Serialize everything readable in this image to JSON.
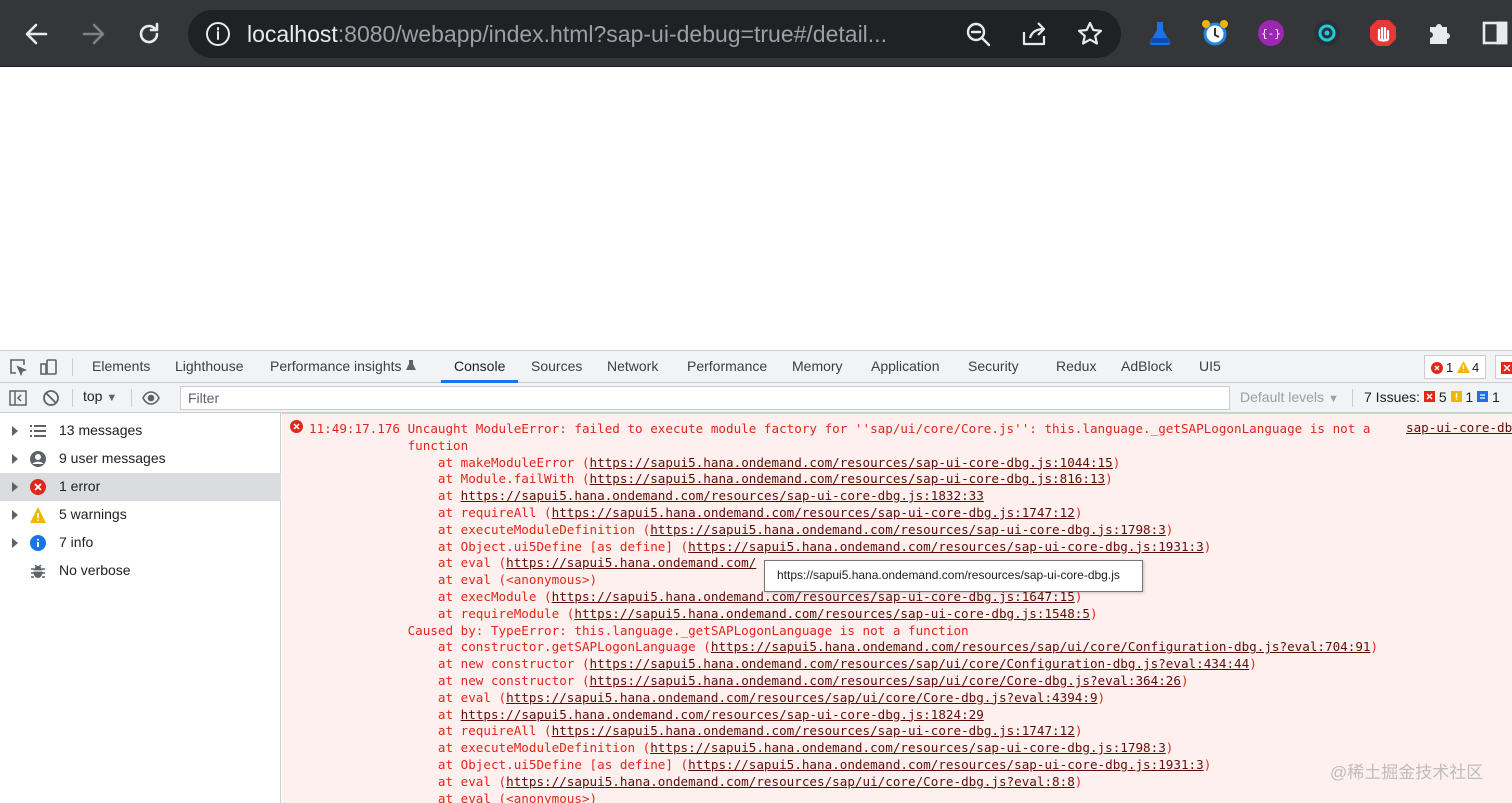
{
  "browser": {
    "url_host": "localhost",
    "url_rest": ":8080/webapp/index.html?sap-ui-debug=true#/detail..."
  },
  "devtools": {
    "tabs": [
      "Elements",
      "Lighthouse",
      "Performance insights",
      "Console",
      "Sources",
      "Network",
      "Performance",
      "Memory",
      "Application",
      "Security",
      "Redux",
      "AdBlock",
      "UI5"
    ],
    "active_tab": "Console",
    "badge": {
      "errors": "1",
      "warnings": "4"
    },
    "toolbar": {
      "context": "top",
      "filter_placeholder": "Filter",
      "levels": "Default levels",
      "issues_label": "7 Issues:",
      "issues_errors": "5",
      "issues_warnings": "1",
      "issues_info": "1"
    },
    "sidebar": [
      {
        "label": "13 messages",
        "icon": "list-icon"
      },
      {
        "label": "9 user messages",
        "icon": "user-icon"
      },
      {
        "label": "1 error",
        "icon": "error-icon",
        "selected": true
      },
      {
        "label": "5 warnings",
        "icon": "warning-icon"
      },
      {
        "label": "7 info",
        "icon": "info-icon"
      },
      {
        "label": "No verbose",
        "icon": "bug-icon"
      }
    ],
    "console": {
      "timestamp": "11:49:17.176",
      "source_link": "sap-ui-core-dbg.js",
      "tooltip": "https://sapui5.hana.ondemand.com/resources/sap-ui-core-dbg.js",
      "lines": [
        {
          "pre": "11:49:17.176 Uncaught ModuleError: failed to execute module factory for ''sap/ui/core/Core.js'': this.language._getSAPLogonLanguage is not a",
          "link": "",
          "post": ""
        },
        {
          "pre": "             function",
          "link": "",
          "post": ""
        },
        {
          "pre": "                 at makeModuleError (",
          "link": "https://sapui5.hana.ondemand.com/resources/sap-ui-core-dbg.js:1044:15",
          "post": ")"
        },
        {
          "pre": "                 at Module.failWith (",
          "link": "https://sapui5.hana.ondemand.com/resources/sap-ui-core-dbg.js:816:13",
          "post": ")"
        },
        {
          "pre": "                 at ",
          "link": "https://sapui5.hana.ondemand.com/resources/sap-ui-core-dbg.js:1832:33",
          "post": ""
        },
        {
          "pre": "                 at requireAll (",
          "link": "https://sapui5.hana.ondemand.com/resources/sap-ui-core-dbg.js:1747:12",
          "post": ")"
        },
        {
          "pre": "                 at executeModuleDefinition (",
          "link": "https://sapui5.hana.ondemand.com/resources/sap-ui-core-dbg.js:1798:3",
          "post": ")"
        },
        {
          "pre": "                 at Object.ui5Define [as define] (",
          "link": "https://sapui5.hana.ondemand.com/resources/sap-ui-core-dbg.js:1931:3",
          "post": ")"
        },
        {
          "pre": "                 at eval (",
          "link": "https://sapui5.hana.ondemand.com/",
          "post": ""
        },
        {
          "pre": "                 at eval (<anonymous>)",
          "link": "",
          "post": ""
        },
        {
          "pre": "                 at execModule (",
          "link": "https://sapui5.hana.ondemand.com/resources/sap-ui-core-dbg.js:1647:15",
          "post": ")"
        },
        {
          "pre": "                 at requireModule (",
          "link": "https://sapui5.hana.ondemand.com/resources/sap-ui-core-dbg.js:1548:5",
          "post": ")"
        },
        {
          "pre": "             Caused by: TypeError: this.language._getSAPLogonLanguage is not a function",
          "link": "",
          "post": ""
        },
        {
          "pre": "                 at constructor.getSAPLogonLanguage (",
          "link": "https://sapui5.hana.ondemand.com/resources/sap/ui/core/Configuration-dbg.js?eval:704:91",
          "post": ")"
        },
        {
          "pre": "                 at new constructor (",
          "link": "https://sapui5.hana.ondemand.com/resources/sap/ui/core/Configuration-dbg.js?eval:434:44",
          "post": ")"
        },
        {
          "pre": "                 at new constructor (",
          "link": "https://sapui5.hana.ondemand.com/resources/sap/ui/core/Core-dbg.js?eval:364:26",
          "post": ")"
        },
        {
          "pre": "                 at eval (",
          "link": "https://sapui5.hana.ondemand.com/resources/sap/ui/core/Core-dbg.js?eval:4394:9",
          "post": ")"
        },
        {
          "pre": "                 at ",
          "link": "https://sapui5.hana.ondemand.com/resources/sap-ui-core-dbg.js:1824:29",
          "post": ""
        },
        {
          "pre": "                 at requireAll (",
          "link": "https://sapui5.hana.ondemand.com/resources/sap-ui-core-dbg.js:1747:12",
          "post": ")"
        },
        {
          "pre": "                 at executeModuleDefinition (",
          "link": "https://sapui5.hana.ondemand.com/resources/sap-ui-core-dbg.js:1798:3",
          "post": ")"
        },
        {
          "pre": "                 at Object.ui5Define [as define] (",
          "link": "https://sapui5.hana.ondemand.com/resources/sap-ui-core-dbg.js:1931:3",
          "post": ")"
        },
        {
          "pre": "                 at eval (",
          "link": "https://sapui5.hana.ondemand.com/resources/sap/ui/core/Core-dbg.js?eval:8:8",
          "post": ")"
        },
        {
          "pre": "                 at eval (<anonymous>)",
          "link": "",
          "post": ""
        }
      ]
    }
  },
  "watermark": "@稀土掘金技术社区"
}
